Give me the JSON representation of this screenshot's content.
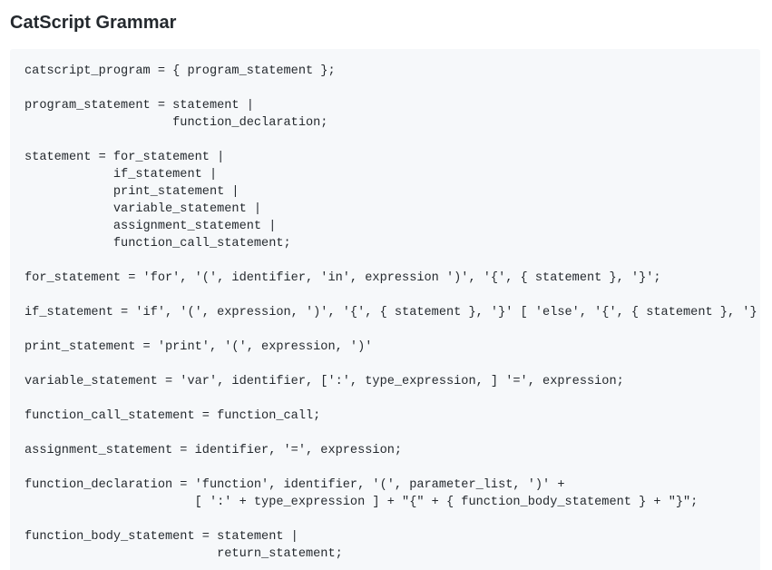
{
  "page": {
    "title": "CatScript Grammar"
  },
  "grammar": {
    "lines": [
      "catscript_program = { program_statement };",
      "",
      "program_statement = statement |",
      "                    function_declaration;",
      "",
      "statement = for_statement |",
      "            if_statement |",
      "            print_statement |",
      "            variable_statement |",
      "            assignment_statement |",
      "            function_call_statement;",
      "",
      "for_statement = 'for', '(', identifier, 'in', expression ')', '{', { statement }, '}';",
      "",
      "if_statement = 'if', '(', expression, ')', '{', { statement }, '}' [ 'else', '{', { statement }, '}' ];",
      "",
      "print_statement = 'print', '(', expression, ')'",
      "",
      "variable_statement = 'var', identifier, [':', type_expression, ] '=', expression;",
      "",
      "function_call_statement = function_call;",
      "",
      "assignment_statement = identifier, '=', expression;",
      "",
      "function_declaration = 'function', identifier, '(', parameter_list, ')' +",
      "                       [ ':' + type_expression ] + \"{\" + { function_body_statement } + \"}\";",
      "",
      "function_body_statement = statement |",
      "                          return_statement;"
    ]
  }
}
